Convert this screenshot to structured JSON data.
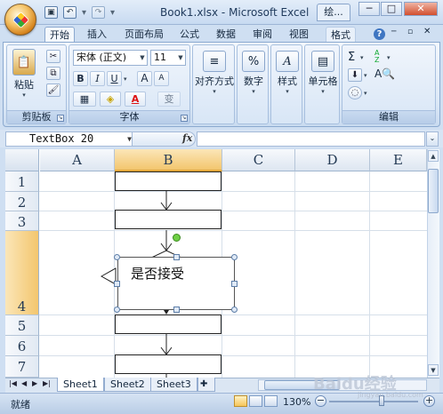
{
  "window": {
    "title": "Book1.xlsx - Microsoft Excel",
    "task_tab": "绘...",
    "btn_min": "─",
    "btn_max": "□",
    "btn_close": "✕"
  },
  "ribbon": {
    "tabs": [
      "开始",
      "插入",
      "页面布局",
      "公式",
      "数据",
      "审阅",
      "视图",
      "格式"
    ],
    "active_tab": "开始",
    "clipboard": {
      "paste_label": "粘贴",
      "group_label": "剪贴板"
    },
    "font": {
      "name": "宋体 (正文)",
      "size": "11",
      "bold": "B",
      "italic": "I",
      "underline": "U",
      "grow": "A",
      "shrink": "A",
      "color_letter": "A",
      "wen": "变",
      "group_label": "字体"
    },
    "alignment": {
      "label": "对齐方式"
    },
    "number": {
      "label": "数字",
      "icon_text": "%"
    },
    "styles": {
      "label": "样式",
      "icon_text": "A"
    },
    "cells": {
      "label": "单元格"
    },
    "editing": {
      "label": "编辑",
      "sigma": "Σ",
      "sort": "A Z",
      "find": "A"
    }
  },
  "formula_bar": {
    "name_box": "TextBox 20",
    "fx": "fx",
    "value": ""
  },
  "grid": {
    "columns": [
      "A",
      "B",
      "C",
      "D",
      "E"
    ],
    "rows": [
      "1",
      "2",
      "3",
      "4",
      "5",
      "6",
      "7"
    ]
  },
  "flowchart": {
    "decision_text": "是否接受"
  },
  "sheets": {
    "tabs": [
      "Sheet1",
      "Sheet2",
      "Sheet3"
    ],
    "active": "Sheet1",
    "nav": [
      "|◀",
      "◀",
      "▶",
      "▶|"
    ]
  },
  "status": {
    "text": "就绪",
    "zoom": "130%",
    "zoom_minus": "−",
    "zoom_plus": "+"
  },
  "watermark": {
    "text": "Baidu经验",
    "sub": "jingyan.baidu.com"
  }
}
